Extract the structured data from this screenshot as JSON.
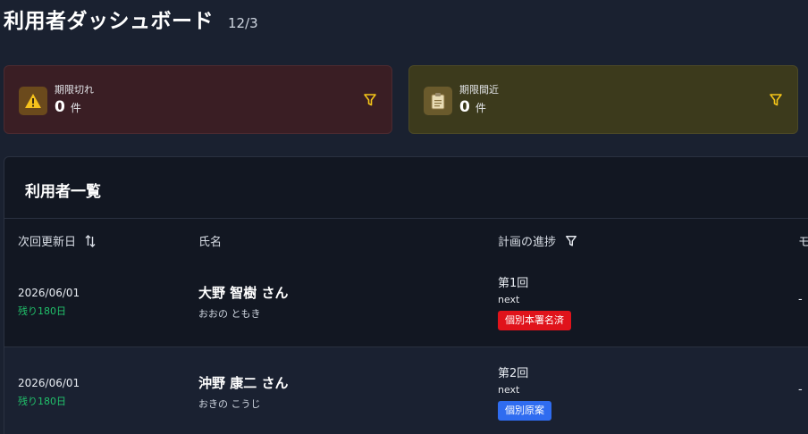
{
  "header": {
    "title": "利用者ダッシュボード",
    "date": "12/3"
  },
  "cards": [
    {
      "label": "期限切れ",
      "count": "0",
      "unit": "件",
      "icon": "warning-icon"
    },
    {
      "label": "期限間近",
      "count": "0",
      "unit": "件",
      "icon": "clipboard-icon"
    }
  ],
  "users_panel": {
    "title": "利用者一覧",
    "columns": [
      "次回更新日",
      "氏名",
      "計画の進捗",
      "モ"
    ],
    "rows": [
      {
        "next_date": "2026/06/01",
        "remaining": "残り180日",
        "name": "大野 智樹 さん",
        "kana": "おおの ともき",
        "round": "第1回",
        "next_label": "next",
        "status": "個別本署名済",
        "memo": "-"
      },
      {
        "next_date": "2026/06/01",
        "remaining": "残り180日",
        "name": "沖野 康二 さん",
        "kana": "おきの こうじ",
        "round": "第2回",
        "next_label": "next",
        "status": "個別原案",
        "memo": "-"
      }
    ]
  },
  "colors": {
    "remaining": "#21c16b",
    "status_signed": "#e0131b",
    "status_draft": "#2f6cf0",
    "filter_icon": "#f5c518"
  }
}
